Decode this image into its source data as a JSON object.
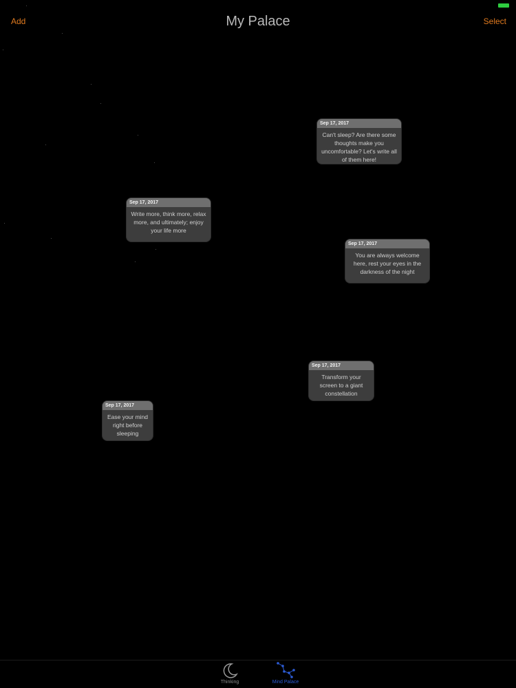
{
  "nav": {
    "title": "My Palace",
    "left_label": "Add",
    "right_label": "Select"
  },
  "notes": [
    {
      "date": "Sep 17, 2017",
      "text": "Can't sleep? Are there some thoughts make you uncomfortable? Let's write all of them here!"
    },
    {
      "date": "Sep 17, 2017",
      "text": "Write more, think more, relax more, and ultimately; enjoy your life more"
    },
    {
      "date": "Sep 17, 2017",
      "text": "You are always welcome here, rest your eyes in the darkness of the night"
    },
    {
      "date": "Sep 17, 2017",
      "text": "Transform your screen to a giant constellation"
    },
    {
      "date": "Sep 17, 2017",
      "text": "Ease your mind right before sleeping"
    }
  ],
  "tabs": [
    {
      "label": "Thinking",
      "icon": "moon-icon",
      "selected": false
    },
    {
      "label": "Mind Palace",
      "icon": "constellation-icon",
      "selected": true
    }
  ],
  "colors": {
    "accent": "#e07a1f",
    "background": "#000000",
    "selected_tab": "#2d5cd6",
    "note_background": "#3d3d3d",
    "note_header": "#6f6f6f",
    "battery": "#2ecc40"
  }
}
